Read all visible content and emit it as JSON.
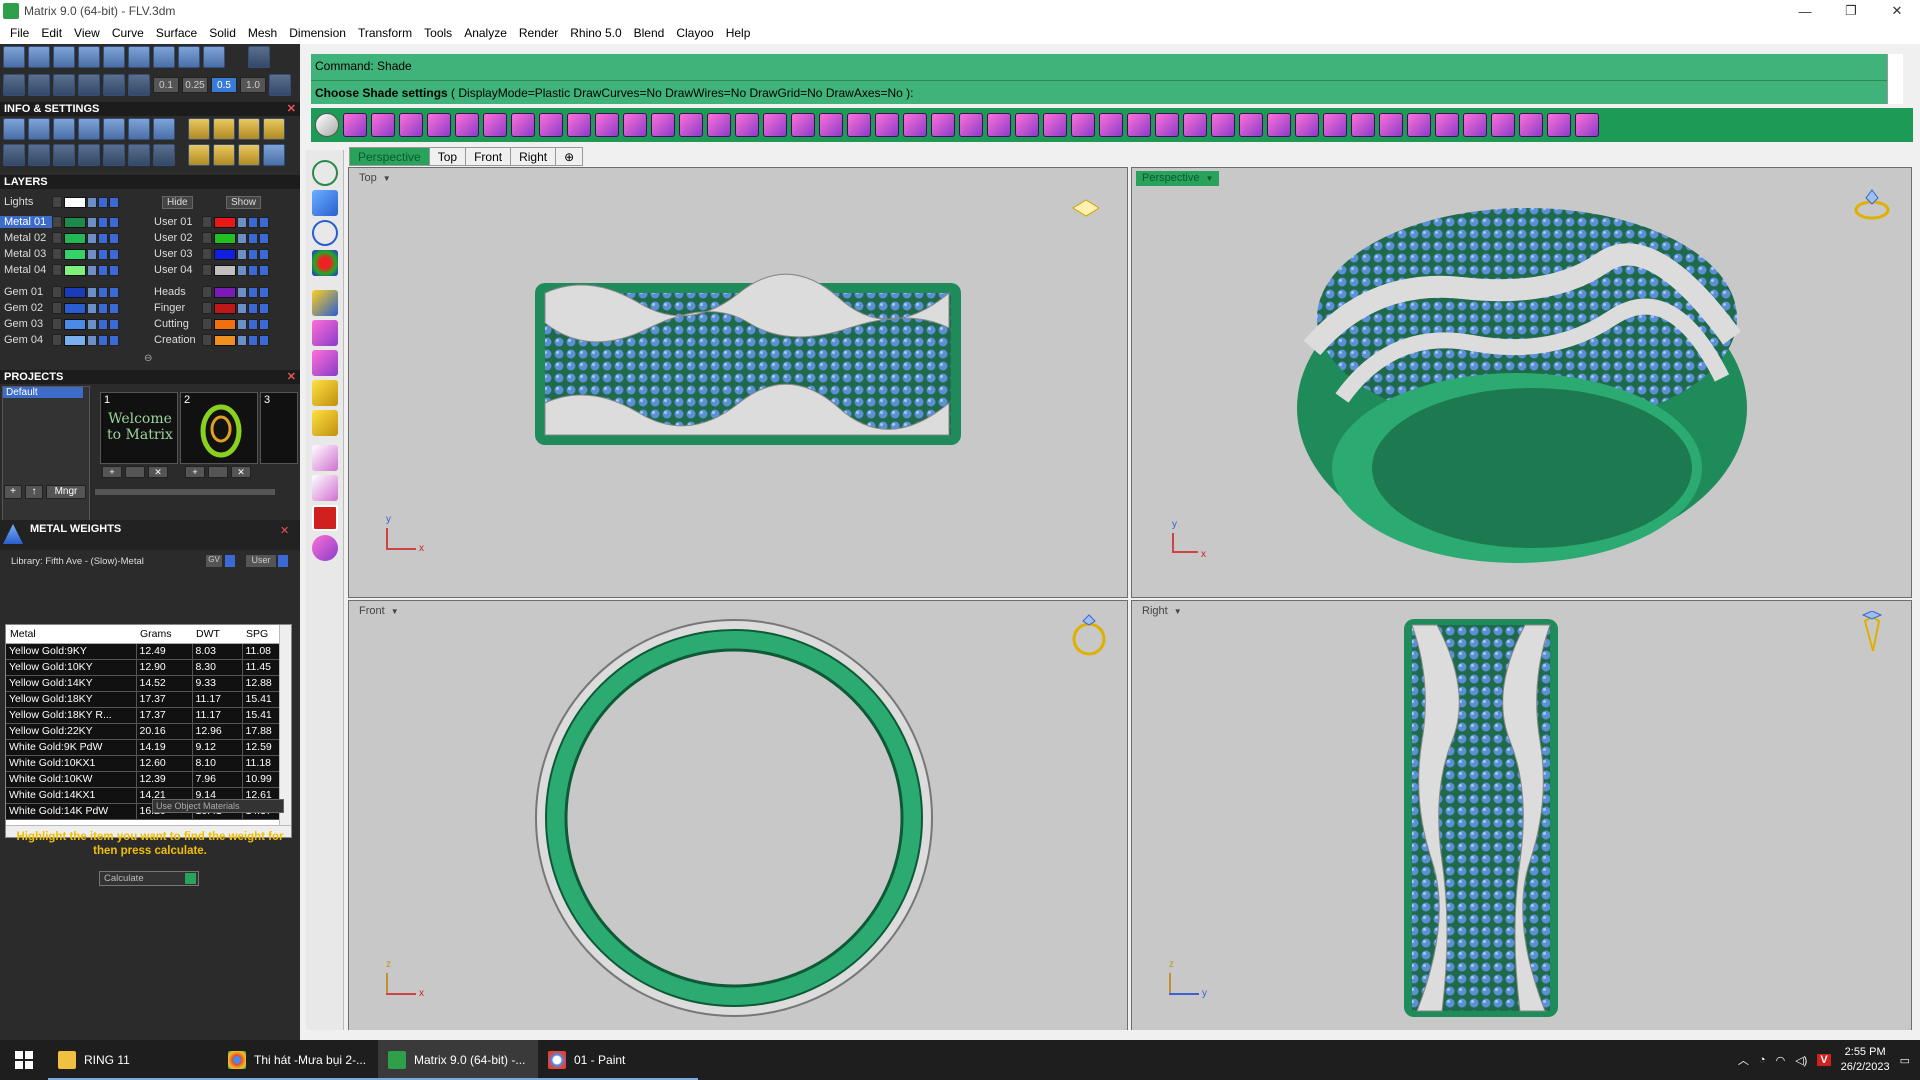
{
  "window": {
    "title": "Matrix 9.0 (64-bit) - FLV.3dm",
    "min": "—",
    "max": "❐",
    "close": "✕"
  },
  "menu": [
    "File",
    "Edit",
    "View",
    "Curve",
    "Surface",
    "Solid",
    "Mesh",
    "Dimension",
    "Transform",
    "Tools",
    "Analyze",
    "Render",
    "Rhino 5.0",
    "Blend",
    "Clayoo",
    "Help"
  ],
  "toolbar_values": [
    "0.1",
    "0.25",
    "0.5",
    "1.0"
  ],
  "info_settings": {
    "title": "INFO & SETTINGS"
  },
  "layers": {
    "title": "LAYERS",
    "lights_label": "Lights",
    "hide_label": "Hide",
    "show_label": "Show",
    "left": [
      {
        "name": "Metal 01",
        "color": "#1c8a4a"
      },
      {
        "name": "Metal 02",
        "color": "#22b855"
      },
      {
        "name": "Metal 03",
        "color": "#34d36a"
      },
      {
        "name": "Metal 04",
        "color": "#7ef07e"
      },
      {
        "name": "Gem 01",
        "color": "#1a3cb8"
      },
      {
        "name": "Gem 02",
        "color": "#2a5ed0"
      },
      {
        "name": "Gem 03",
        "color": "#4a8ae8"
      },
      {
        "name": "Gem 04",
        "color": "#7ab0f0"
      }
    ],
    "right": [
      {
        "name": "User 01",
        "color": "#e81818"
      },
      {
        "name": "User 02",
        "color": "#20c020"
      },
      {
        "name": "User 03",
        "color": "#1020e0"
      },
      {
        "name": "User 04",
        "color": "#c0c0c0"
      },
      {
        "name": "Heads",
        "color": "#7a1ab8"
      },
      {
        "name": "Finger",
        "color": "#c01818"
      },
      {
        "name": "Cutting",
        "color": "#f07010"
      },
      {
        "name": "Creation",
        "color": "#f09020"
      }
    ]
  },
  "projects": {
    "title": "PROJECTS",
    "items": [
      "Default"
    ],
    "thumbs": [
      "1",
      "2",
      "3"
    ],
    "welcome": "Welcome to Matrix",
    "mngr": "Mngr"
  },
  "metal_weights": {
    "title": "METAL WEIGHTS",
    "library": "Library: Fifth Ave - (Slow)-Metal",
    "gv": "GV",
    "user": "User",
    "columns": [
      "Metal",
      "Grams",
      "DWT",
      "SPG"
    ],
    "rows": [
      [
        "Yellow Gold:9KY",
        "12.49",
        "8.03",
        "11.08"
      ],
      [
        "Yellow Gold:10KY",
        "12.90",
        "8.30",
        "11.45"
      ],
      [
        "Yellow Gold:14KY",
        "14.52",
        "9.33",
        "12.88"
      ],
      [
        "Yellow Gold:18KY",
        "17.37",
        "11.17",
        "15.41"
      ],
      [
        "Yellow Gold:18KY R...",
        "17.37",
        "11.17",
        "15.41"
      ],
      [
        "Yellow Gold:22KY",
        "20.16",
        "12.96",
        "17.88"
      ],
      [
        "White Gold:9K PdW",
        "14.19",
        "9.12",
        "12.59"
      ],
      [
        "White Gold:10KX1",
        "12.60",
        "8.10",
        "11.18"
      ],
      [
        "White Gold:10KW",
        "12.39",
        "7.96",
        "10.99"
      ],
      [
        "White Gold:14KX1",
        "14.21",
        "9.14",
        "12.61"
      ],
      [
        "White Gold:14K PdW",
        "16.20",
        "10.41",
        "14.37"
      ]
    ],
    "use_object_materials": "Use Object Materials",
    "hint": "Highlight the item you want to find the weight for then press calculate.",
    "calculate": "Calculate"
  },
  "command": {
    "line1": "Command: Shade",
    "prompt": "Choose Shade settings",
    "options": "( DisplayMode=Plastic  DrawCurves=No  DrawWires=No  DrawGrid=No  DrawAxes=No ):"
  },
  "view_tabs": [
    "Perspective",
    "Top",
    "Front",
    "Right"
  ],
  "add_tab": "⊕",
  "viewports": {
    "top": {
      "label": "Top",
      "ax1": "y",
      "ax2": "x"
    },
    "perspective": {
      "label": "Perspective",
      "ax1": "y",
      "ax2": "x"
    },
    "front": {
      "label": "Front",
      "ax1": "z",
      "ax2": "x"
    },
    "right": {
      "label": "Right",
      "ax1": "z",
      "ax2": "y"
    }
  },
  "taskbar": {
    "items": [
      "RING 11",
      "Thi hát -Mưa bụi 2-...",
      "Matrix 9.0 (64-bit) -...",
      "01 - Paint"
    ],
    "time": "2:55 PM",
    "date": "26/2/2023",
    "lang": "V"
  },
  "colors": {
    "accent": "#29a35c",
    "metal": "#1f8a5a",
    "gem": "#5b8fd6",
    "silver": "#d8d8d8"
  }
}
